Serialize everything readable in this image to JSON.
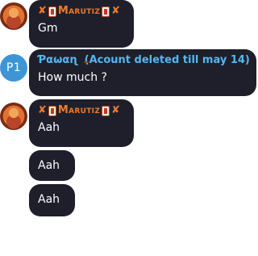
{
  "messages": [
    {
      "sender": "Marutiz",
      "sender_color": "#f07a2a",
      "avatar": "orange-character-avatar",
      "text": "Gm"
    },
    {
      "sender": "Ƥαωαɳ",
      "sender_suffix": "(Acount deleted till may 14)",
      "sender_color": "#55b7f2",
      "avatar_initials": "P1",
      "avatar_color": "#3d95d6",
      "text": "How much ?"
    },
    {
      "sender": "Marutiz",
      "sender_color": "#f07a2a",
      "avatar": "orange-character-avatar",
      "text": "Aah"
    },
    {
      "text": "Aah"
    },
    {
      "text": "Aah"
    }
  ],
  "colors": {
    "bubble": "#1e1f2b",
    "background": "#ffffff"
  }
}
